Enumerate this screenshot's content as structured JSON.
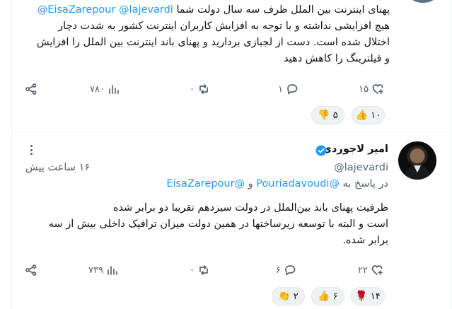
{
  "tweet_prev": {
    "mention_a": "@EisaZarepour",
    "mention_b": "@lajevardi",
    "line1_text": "پهنای اینترنت بین الملل ظرف سه سال دولت شما",
    "line2": "هیچ افزایشی نداشته و با توجه به افزایش کاربران اینترنت کشور به شدت دچار",
    "line3": "اختلال شده است. دست از لجبازی بردارید و پهنای باند اینترنت بین الملل را افزایش",
    "line4": "و فیلترینگ را کاهش دهید",
    "actions": {
      "replies": "۱",
      "retweets": "۰",
      "likes": "۱۵",
      "views": "۷۸۰"
    },
    "reactions": [
      {
        "emoji": "👍",
        "count": "۱۰"
      },
      {
        "emoji": "👎",
        "count": "۵"
      }
    ]
  },
  "tweet_main": {
    "author_name": "امیر لاجوردی",
    "handle": "@lajevardi",
    "time": "۱۶ ساعت پیش",
    "reply_prefix": "در پاسخ به",
    "reply_to_a": "@Pouriadavoudi",
    "reply_and": "و",
    "reply_to_b": "@EisaZarepour",
    "body_line1": "ظرفیت پهنای باند بین‌الملل در دولت سیزدهم تقریبا دو برابر شده",
    "body_line2": "است و البته با توسعه زیرساختها در همین دولت میزان ترافیک داخلی بیش از سه",
    "body_line3": "برابر شده.",
    "actions": {
      "replies": "۶",
      "retweets": "۰",
      "likes": "۲۲",
      "views": "۷۳۹"
    },
    "reactions": [
      {
        "emoji": "🌹",
        "count": "۱۴"
      },
      {
        "emoji": "👍",
        "count": "۶"
      },
      {
        "emoji": "👏",
        "count": "۲"
      }
    ]
  },
  "colors": {
    "accent": "#1d9bf0",
    "muted": "#536471",
    "verified": "#1d9bf0"
  },
  "icons": [
    "share-icon",
    "views-icon",
    "retweet-icon",
    "reply-icon",
    "like-icon",
    "more-icon",
    "verified-icon"
  ]
}
